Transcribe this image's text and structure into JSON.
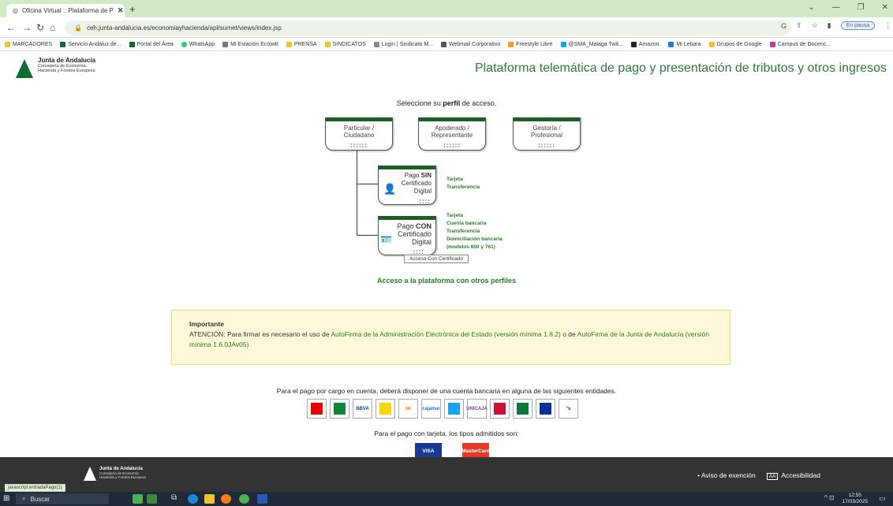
{
  "browser": {
    "tab_title": "Oficina Virtual :: Plataforma de P",
    "url": "ceh.junta-andalucia.es/economiayhacienda/apl/surnet/views/index.jsp",
    "paused_label": "En pausa",
    "bookmarks": [
      "MARCADORES",
      "Servicio Andaluz de...",
      "Portal del Área",
      "WhatsApp",
      "Mi Estación Ecowitt",
      "PRENSA",
      "SINDICATOS",
      "Login | Sindicato M...",
      "Webmail Corporativo",
      "Freestyle Libre",
      "@SMA_Malaga Twit...",
      "Amazon.",
      "Mi Lebara",
      "Grupos de Google",
      "Campus de Docenc..."
    ]
  },
  "header": {
    "logo_title": "Junta de Andalucía",
    "logo_line1": "Consejería de Economía,",
    "logo_line2": "Hacienda y Fondos Europeos",
    "platform_title": "Plataforma telemática de pago y presentación de tributos y otros ingresos"
  },
  "select": {
    "prefix": "Seleccione su ",
    "bold": "perfil",
    "suffix": " de acceso."
  },
  "profiles": [
    {
      "l1": "Particular /",
      "l2": "Ciudadano"
    },
    {
      "l1": "Apoderado /",
      "l2": "Representante"
    },
    {
      "l1": "Gestoría /",
      "l2": "Profesional"
    }
  ],
  "pay_sin": {
    "l1a": "Pago ",
    "l1b": "SIN",
    "l2": "Certificado",
    "l3": "Digital",
    "options": [
      "Tarjeta",
      "Transferencia"
    ]
  },
  "pay_con": {
    "l1a": "Pago ",
    "l1b": "CON",
    "l2": "Certificado",
    "l3": "Digital",
    "options": [
      "Tarjeta",
      "Cuenta bancaria",
      "Transferencia",
      "Domiciliación bancaria",
      "(modelos 650 y 761)"
    ]
  },
  "tooltip": "Acceso Con Certificado",
  "other_profiles": "Acceso a la plataforma con otros perfiles",
  "important": {
    "title": "Importante",
    "t1": "ATENCIÓN: Para firmar es necesario el uso de ",
    "link1": "AutoFirma de la Administración Electrónica del Estado (versión mínima 1.8.2)",
    "t2": " o de ",
    "link2": "AutoFirma de la Junta de Andalucía (versión mínima 1.6.0JAv05)"
  },
  "bank_text": "Para el pago por cargo en cuenta, deberá disponer de una cuenta bancaria en alguna de las siguientes entidades.",
  "banks": [
    {
      "label": "",
      "color": "#e60000"
    },
    {
      "label": "",
      "color": "#0a8a3a"
    },
    {
      "label": "BBVA",
      "color": "#0a4da0"
    },
    {
      "label": "",
      "color": "#ffd400"
    },
    {
      "label": "bk",
      "color": "#ff7a00"
    },
    {
      "label": "cajamar",
      "color": "#2a6fbf"
    },
    {
      "label": "",
      "color": "#1aa3e8"
    },
    {
      "label": "UNICAJA",
      "color": "#6a3fa0"
    },
    {
      "label": "",
      "color": "#d0103a"
    },
    {
      "label": "",
      "color": "#0a7a3a"
    },
    {
      "label": "",
      "color": "#003399"
    },
    {
      "label": "°s",
      "color": "#003399"
    }
  ],
  "card_text": "Para el pago con tarjeta, los tipos admitidos son:",
  "cards": [
    {
      "label": "VISA",
      "color": "#1a3a8f"
    },
    {
      "label": "MasterCard",
      "color": "#e53a2a"
    }
  ],
  "footer": {
    "logo_title": "Junta de Andalucía",
    "logo_line1": "Consejería de Economía,",
    "logo_line2": "Hacienda y Fondos Europeos",
    "aviso": "• Aviso de exención",
    "aa": "AA",
    "accesibilidad": "Accesibilidad"
  },
  "status_url": "javascript:entradaPago(1)",
  "taskbar": {
    "search": "Buscar",
    "time": "12:55",
    "date": "17/03/2025"
  }
}
